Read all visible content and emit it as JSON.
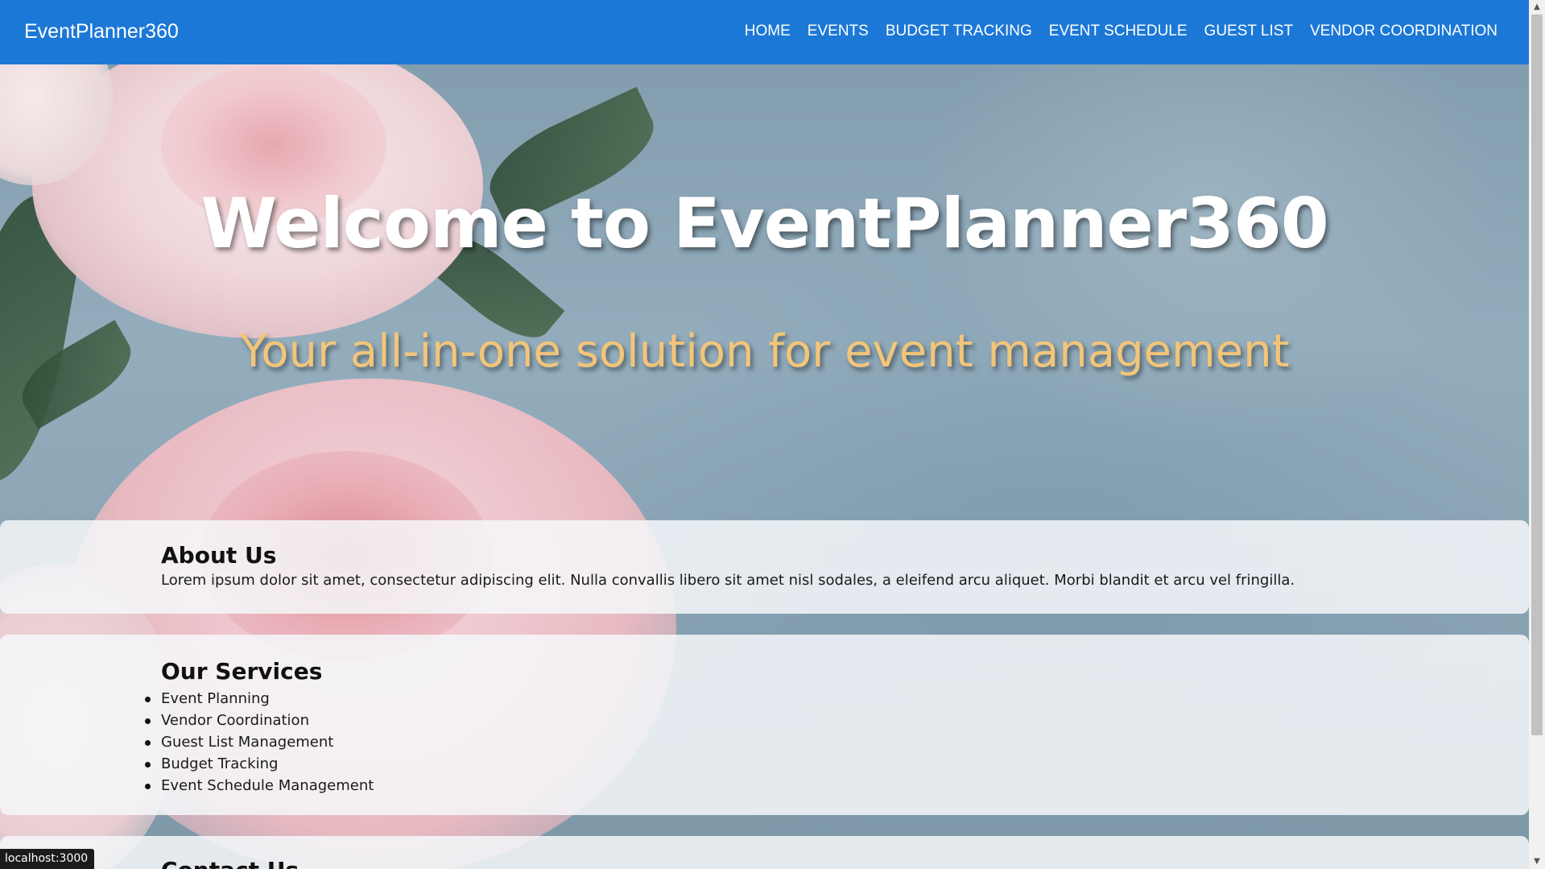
{
  "navbar": {
    "brand": "EventPlanner360",
    "links": [
      "HOME",
      "EVENTS",
      "BUDGET TRACKING",
      "EVENT SCHEDULE",
      "GUEST LIST",
      "VENDOR COORDINATION"
    ],
    "background_color": "#1c78d6"
  },
  "hero": {
    "title": "Welcome to EventPlanner360",
    "subtitle": "Your all-in-one solution for event management",
    "title_color": "#ffffff",
    "subtitle_color": "#f2c57a"
  },
  "about": {
    "heading": "About Us",
    "text": "Lorem ipsum dolor sit amet, consectetur adipiscing elit. Nulla convallis libero sit amet nisl sodales, a eleifend arcu aliquet. Morbi blandit et arcu vel fringilla."
  },
  "services": {
    "heading": "Our Services",
    "items": [
      "Event Planning",
      "Vendor Coordination",
      "Guest List Management",
      "Budget Tracking",
      "Event Schedule Management"
    ]
  },
  "contact": {
    "heading": "Contact Us"
  },
  "status_bar": {
    "url": "localhost:3000"
  }
}
